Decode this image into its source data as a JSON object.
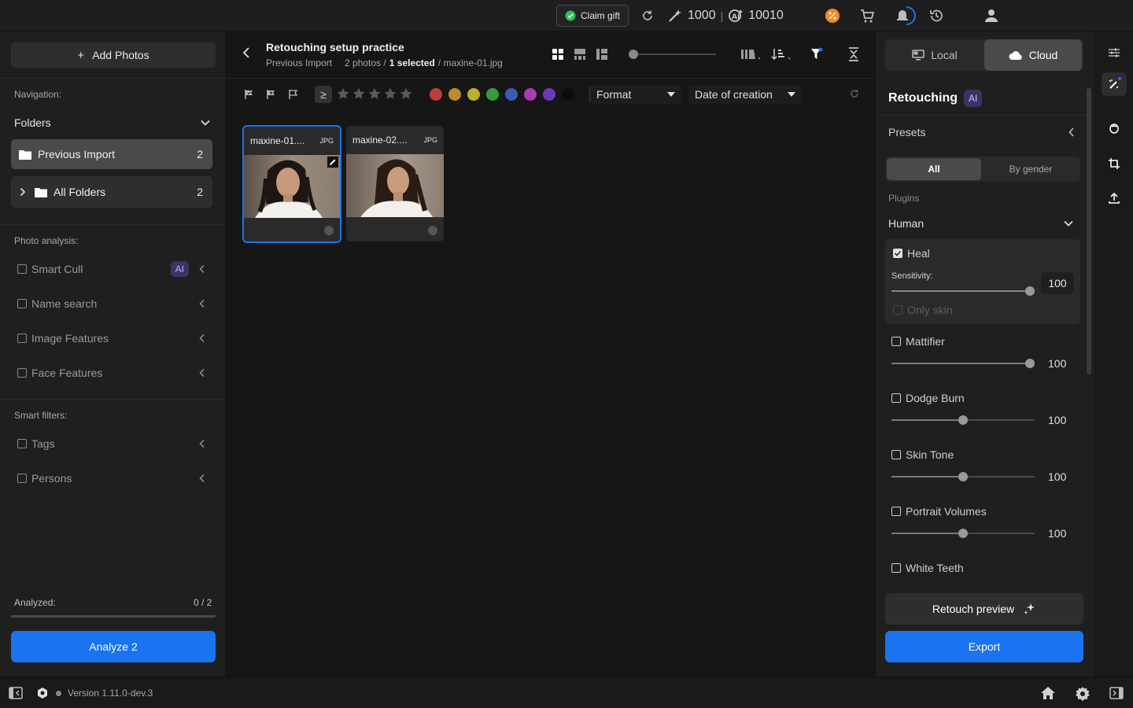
{
  "topbar": {
    "claim_gift": "Claim gift",
    "credits_a": "1000",
    "credits_separator": "|",
    "credits_b": "10010",
    "icons": [
      "refresh-icon",
      "magic-wand-icon",
      "ai-credits-icon",
      "discount-icon",
      "cart-icon",
      "notification-icon",
      "history-icon",
      "user-icon"
    ]
  },
  "left": {
    "add_photos": "Add Photos",
    "add_icon_glyph": "+",
    "navigation_label": "Navigation:",
    "folders_label": "Folders",
    "folders": [
      {
        "label": "Previous Import",
        "count": "2"
      },
      {
        "label": "All Folders",
        "count": "2"
      }
    ],
    "photo_analysis_label": "Photo analysis:",
    "analysis": [
      {
        "label": "Smart Cull",
        "badge": "AI"
      },
      {
        "label": "Name search"
      },
      {
        "label": "Image Features"
      },
      {
        "label": "Face Features"
      }
    ],
    "smart_filters_label": "Smart filters:",
    "smart_filters": [
      {
        "label": "Tags"
      },
      {
        "label": "Persons"
      }
    ],
    "analyzed_label": "Analyzed:",
    "analyzed_value": "0 / 2",
    "analyze_button": "Analyze 2"
  },
  "header": {
    "title": "Retouching setup practice",
    "breadcrumb_folder": "Previous Import",
    "photos_count": "2 photos /",
    "selected": "1 selected",
    "selected_file": "/ maxine-01.jpg",
    "thumb_size": 0.0
  },
  "filters": {
    "rating_operator": "≥",
    "stars": 5,
    "colors": [
      "#c23b3b",
      "#c08a2a",
      "#b7b22a",
      "#3c9a3c",
      "#3a5cb5",
      "#a83ab3",
      "#6b3ab8",
      "#0d0d0d"
    ],
    "format_label": "Format",
    "sort_label": "Date of creation"
  },
  "thumbnails": [
    {
      "name": "maxine-01....",
      "format": "JPG",
      "selected": true
    },
    {
      "name": "maxine-02....",
      "format": "JPG",
      "selected": false
    }
  ],
  "right": {
    "local_label": "Local",
    "cloud_label": "Cloud",
    "retouching_title": "Retouching",
    "ai_badge": "AI",
    "presets_label": "Presets",
    "preset_tabs": [
      "All",
      "By gender"
    ],
    "plugins_label": "Plugins",
    "plugin_group": "Human",
    "heal": {
      "label": "Heal",
      "checked": true,
      "sensitivity_label": "Sensitivity:",
      "value": "100",
      "only_skin": "Only skin"
    },
    "plugins": [
      {
        "label": "Mattifier",
        "value": "100",
        "level": 1.0
      },
      {
        "label": "Dodge Burn",
        "value": "100",
        "level": 0.5
      },
      {
        "label": "Skin Tone",
        "value": "100",
        "level": 0.5
      },
      {
        "label": "Portrait Volumes",
        "value": "100",
        "level": 0.5
      }
    ],
    "white_teeth": "White Teeth",
    "retouch_preview": "Retouch preview",
    "export": "Export"
  },
  "bottom": {
    "version": "Version 1.11.0-dev.3"
  },
  "colors": {
    "accent": "#1a73f0",
    "ai_badge_bg": "#3a3466"
  }
}
